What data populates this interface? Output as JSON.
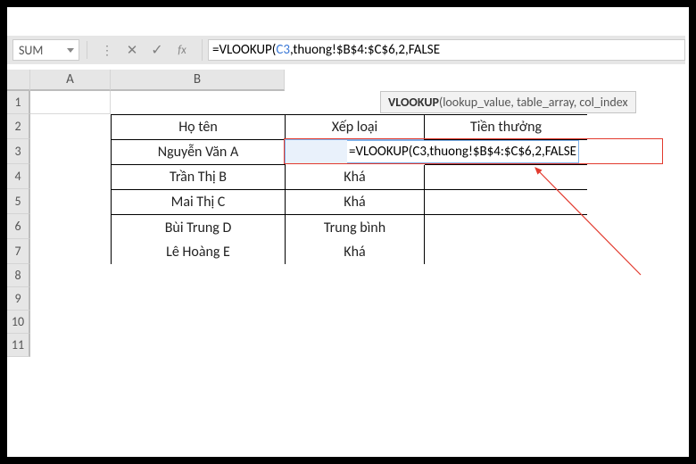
{
  "name_box": "SUM",
  "formula_bar": {
    "prefix": "=VLOOKUP(",
    "ref": "C3",
    "suffix": ",thuong!$B$4:$C$6,2,FALSE"
  },
  "tooltip": {
    "bold": "VLOOKUP",
    "rest": "(lookup_value, table_array, col_index"
  },
  "columns": [
    "A",
    "B"
  ],
  "rows": [
    "1",
    "2",
    "3",
    "4",
    "5",
    "6",
    "7",
    "8",
    "9",
    "10",
    "11"
  ],
  "headers": {
    "b": "Họ tên",
    "c": "Xếp loại",
    "d": "Tiền thưởng"
  },
  "table": {
    "names": [
      "Nguyễn Văn A",
      "Trần Thị B",
      "Mai Thị C",
      "Bùi Trung D",
      "Lê Hoàng E"
    ],
    "ranks": [
      "",
      "Khá",
      "Khá",
      "Trung bình",
      "Khá"
    ]
  },
  "cell_formula": "=VLOOKUP(C3,thuong!$B$4:$C$6,2,FALSE"
}
